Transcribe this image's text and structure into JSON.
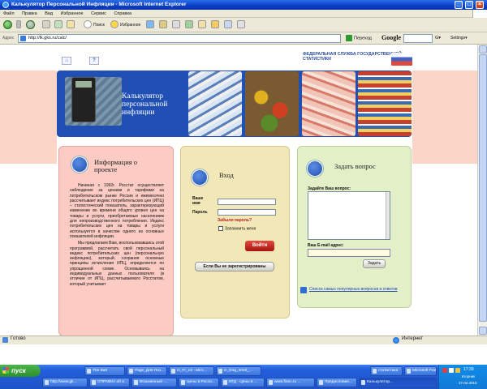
{
  "window": {
    "title": "Калькулятор Персональной Инфляции - Microsoft Internet Explorer",
    "minimize": "_",
    "maximize": "□",
    "close": "×"
  },
  "menu": [
    "Файл",
    "Правка",
    "Вид",
    "Избранное",
    "Сервис",
    "Справка"
  ],
  "toolbar": {
    "search_label": "Поиск",
    "favorites_label": "Избранное"
  },
  "address": {
    "label": "Адрес",
    "url": "http://lk.gks.ru/calc/",
    "go_label": "Переход",
    "google_label": "Google",
    "google_suffix": "G▾",
    "settings_label": "Settings▾"
  },
  "header": {
    "icon_home": "⌂",
    "icon_help": "?",
    "agency": "ФЕДЕРАЛЬНАЯ СЛУЖБА ГОСУДАРСТВЕННОЙ СТАТИСТИКИ"
  },
  "banner": {
    "title": "Калькулятор персональной инфляции"
  },
  "info": {
    "title": "Информация о проекте",
    "p1": "Начиная с 1992г. Росстат осуществляет наблюдение за ценами и тарифами на потребительском рынке России и ежемесячно рассчитывает индекс потребительских цен (ИПЦ) – статистический показатель, характеризующий изменение во времени общего уровня цен на товары и услуги, приобретаемые населением для непроизводственного потребления. Индекс потребительских цен на товары и услуги используется в качестве одного из основных показателей инфляции.",
    "p2": "Мы предлагаем Вам, воспользовавшись этой программой, рассчитать свой персональный индекс потребительских цен (персональную инфляцию), который, сохраняя основные принципы исчисления ИПЦ, определяется по упрощенной схеме. Основываясь на индивидуальных данных пользователя (в отличие от ИПЦ, рассчитываемого Росстатом, который учитывает"
  },
  "login": {
    "title": "Вход",
    "name_label": "Ваше имя",
    "password_label": "Пароль",
    "forgot": "Забыли пароль?",
    "remember": "Запомнить меня",
    "submit": "Войти",
    "not_registered": "Если Вы не зарегистрированы"
  },
  "ask": {
    "title": "Задать вопрос",
    "question_label": "Задайте Ваш вопрос:",
    "email_label": "Ваш E-mail адрес:",
    "submit": "Задать",
    "faq_link": "Список самых популярных вопросов и ответов"
  },
  "status": {
    "ready": "Готово",
    "zone": "Интернет"
  },
  "taskbar": {
    "start": "пуск",
    "row1": [
      "The Bat!",
      "Page_Для Поз...",
      "in_Fr_L5 - Micr...",
      "in_Eng_2010_...",
      "статистика",
      "Microsoft Pow..."
    ],
    "row2": [
      "http://www.gk...",
      "СПРАВКА об и...",
      "Возьменный -...",
      "Цены в Росси...",
      "ИГД - Цены в ...",
      "www.finec.ru ...",
      "Предисловие...",
      "Калькулятор..."
    ],
    "clock": "17:39",
    "day": "вторник",
    "date": "27.04.2010"
  },
  "colors": {
    "info_panel": "#fbcbc4",
    "login_panel": "#f2e7b7",
    "ask_panel": "#e3efc7",
    "banner": "#2150b4",
    "login_button": "#c82a20"
  }
}
